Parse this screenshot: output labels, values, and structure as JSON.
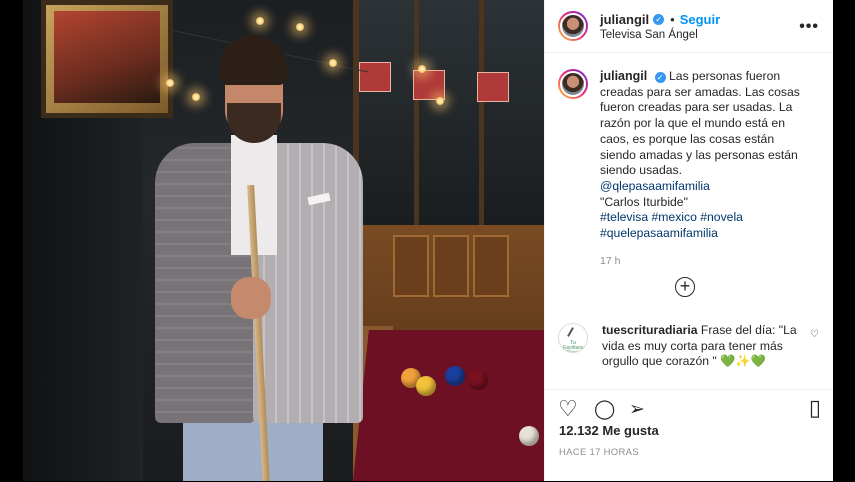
{
  "post": {
    "username": "juliangil",
    "follow_label": "Seguir",
    "separator": "•",
    "location": "Televisa San Ángel",
    "more_glyph": "•••",
    "verified_glyph": "✓"
  },
  "caption": {
    "username": "juliangil",
    "text": "Las personas fueron creadas para ser amadas. Las cosas fueron creadas para ser usadas. La razón por la que el mundo está en caos, es porque las cosas están siendo amadas y las personas están siendo usadas.",
    "mention": "@qlepasaamifamilia",
    "quote": "\"Carlos Iturbide\"",
    "hashtags_line1": "#televisa #mexico #novela",
    "hashtags_line2": "#quelepasaamifamilia",
    "time": "17 h"
  },
  "load_more_glyph": "+",
  "comment": {
    "username": "tuescrituradiaria",
    "text": "Frase del día: \"La vida es muy corta para tener más orgullo que corazón \" 💚✨💚",
    "avatar_caption": "Tu Escritura Diaria",
    "like_icon": "heart-outline-icon"
  },
  "actions": {
    "like_glyph": "♡",
    "comment_glyph": "◯",
    "share_glyph": "➢",
    "save_glyph": "▯",
    "likes": "12.132 Me gusta",
    "ago": "HACE 17 HORAS"
  },
  "colors": {
    "link": "#00376b",
    "follow": "#0095f6",
    "verified": "#3897f0"
  }
}
